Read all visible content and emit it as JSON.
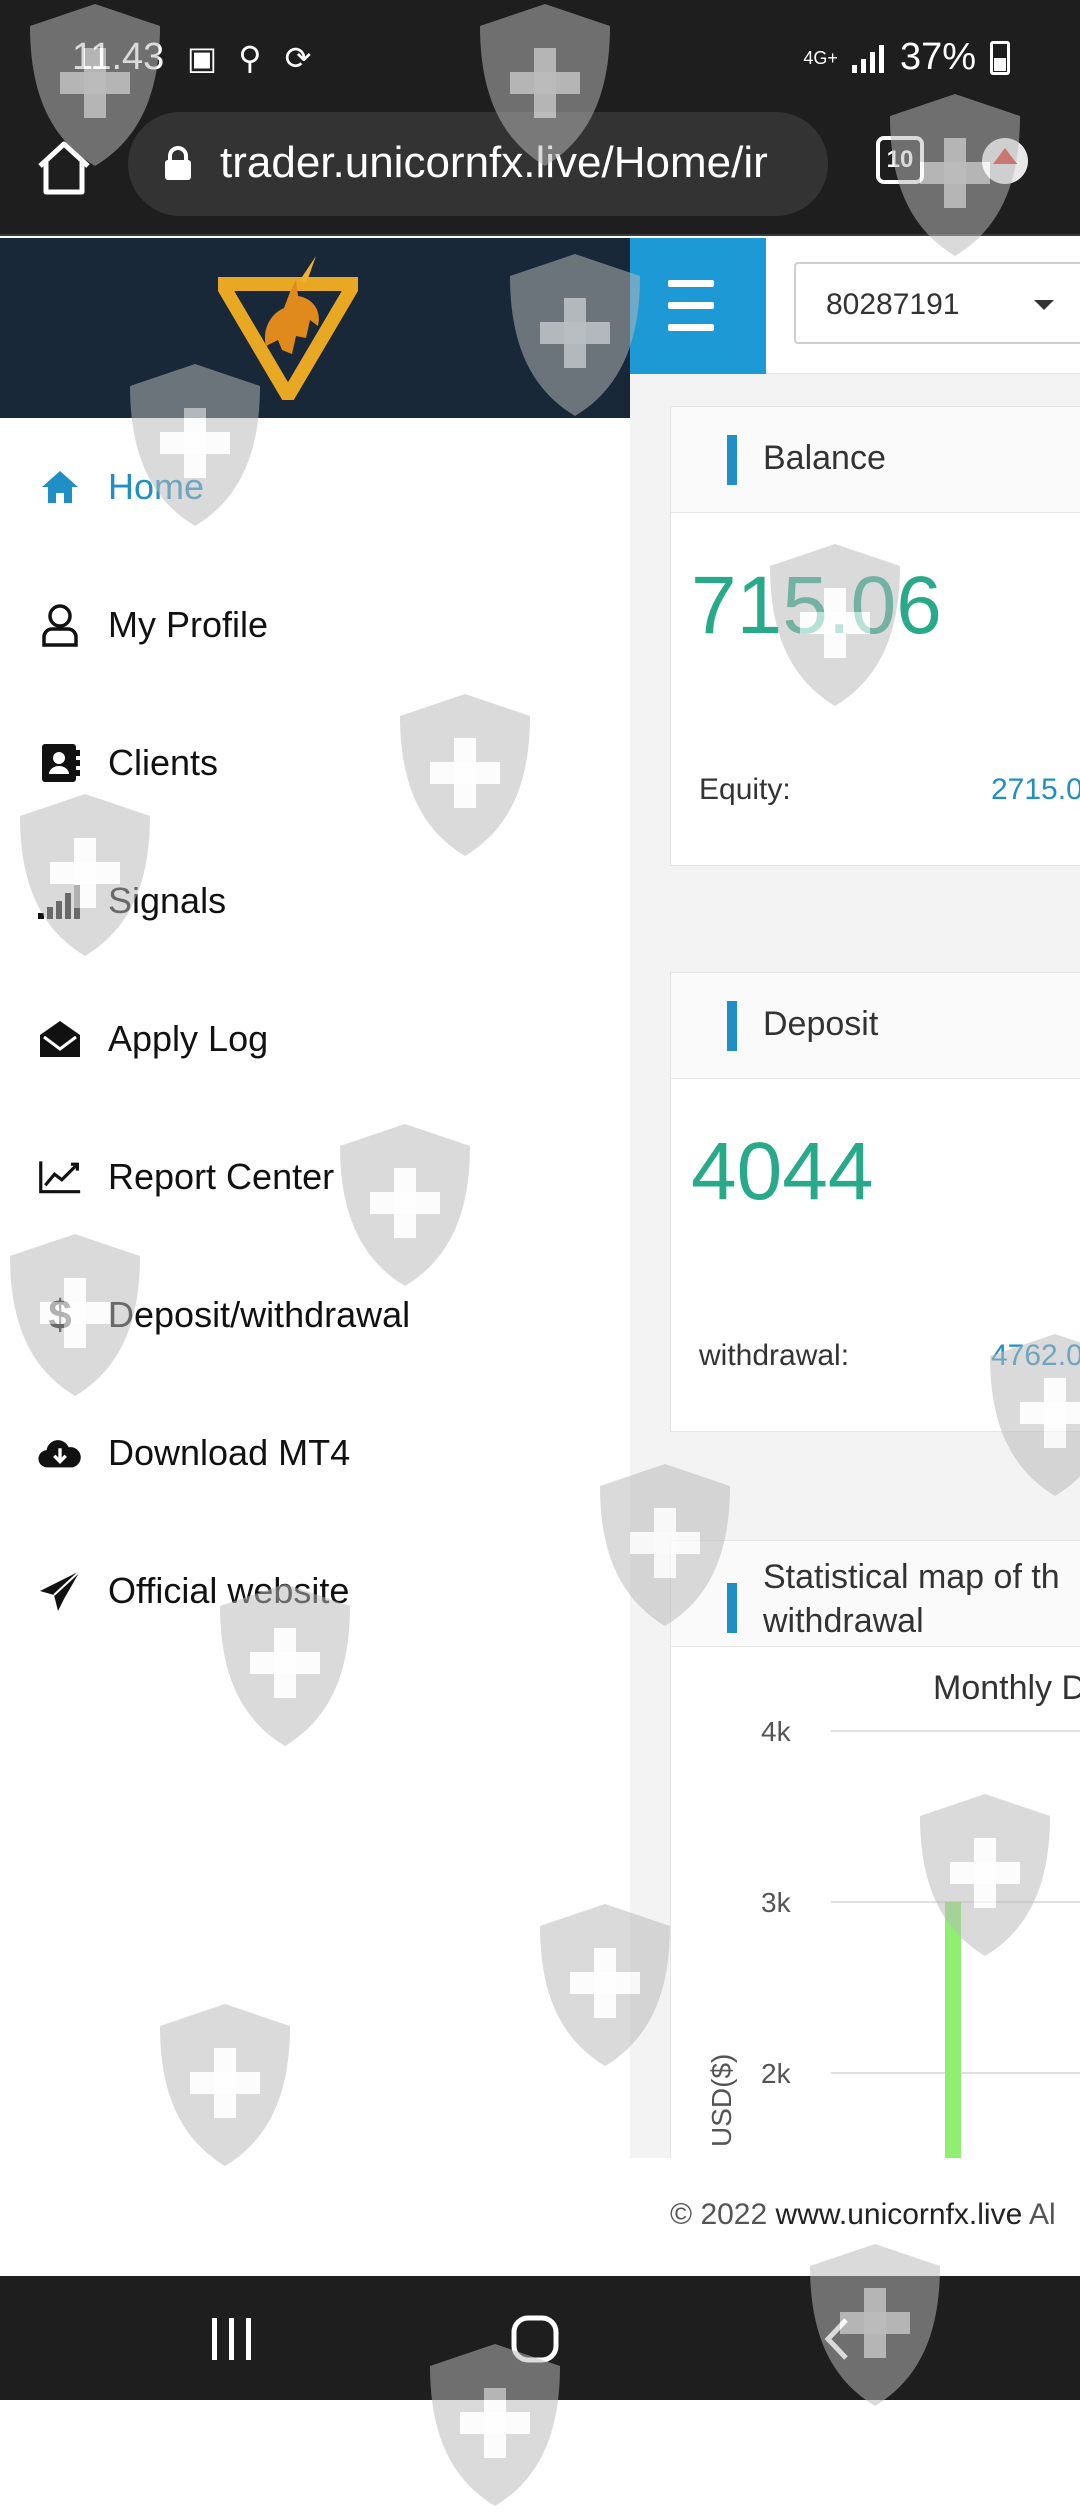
{
  "status_bar": {
    "time": "11.43",
    "network": "4G+",
    "battery": "37%"
  },
  "browser": {
    "url": "trader.unicornfx.live/Home/ir",
    "tab_count": "10"
  },
  "header": {
    "account_number": "80287191"
  },
  "sidebar": {
    "items": [
      {
        "label": "Home",
        "icon": "home-icon",
        "active": true
      },
      {
        "label": "My Profile",
        "icon": "user-icon"
      },
      {
        "label": "Clients",
        "icon": "address-book-icon"
      },
      {
        "label": "Signals",
        "icon": "signal-icon"
      },
      {
        "label": "Apply Log",
        "icon": "envelope-open-icon"
      },
      {
        "label": "Report Center",
        "icon": "line-chart-icon"
      },
      {
        "label": "Deposit/withdrawal",
        "icon": "dollar-icon"
      },
      {
        "label": "Download MT4",
        "icon": "cloud-download-icon"
      },
      {
        "label": "Official website",
        "icon": "paper-plane-icon"
      }
    ]
  },
  "balance_card": {
    "title": "Balance",
    "value": "715.06",
    "equity_label": "Equity:",
    "equity_value": "2715.0"
  },
  "deposit_card": {
    "title": "Deposit",
    "value": "4044",
    "withdrawal_label": "withdrawal:",
    "withdrawal_value": "4762.0"
  },
  "chart_card": {
    "title_line1": "Statistical map of th",
    "title_line2": "withdrawal"
  },
  "chart_data": {
    "type": "bar",
    "title": "Monthly D",
    "ylabel": "USD($)",
    "yticks": [
      "4k",
      "3k",
      "2k"
    ],
    "ylim": [
      2000,
      4000
    ],
    "series": [
      {
        "values": [
          3000
        ],
        "color": "#90ee70"
      }
    ]
  },
  "footer": {
    "copyright": "© 2022",
    "site": "www.unicornfx.live",
    "rest": "Al"
  },
  "colors": {
    "accent": "#1f8fc6",
    "value_green": "#27a98a",
    "header_dark": "#182838"
  }
}
